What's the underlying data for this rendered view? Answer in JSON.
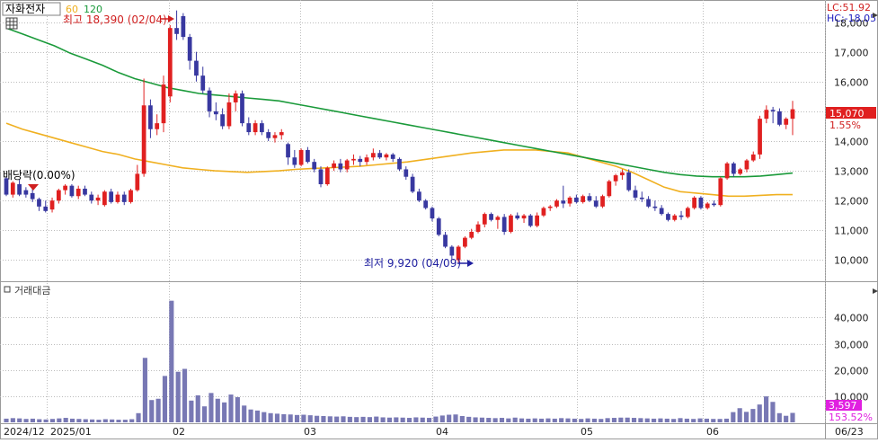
{
  "legend": {
    "symbol": "자화전자",
    "ma60_label": "60",
    "ma120_label": "120"
  },
  "colors": {
    "up": "#e02020",
    "down": "#3838a0",
    "ma60": "#f0b020",
    "ma120": "#1a9a3a",
    "volume": "#7878b4",
    "grid": "#bcbcbc",
    "annotation": "#d02020",
    "annotation_low": "#2020a0",
    "price_tag_bg": "#e02020",
    "volume_tag_bg": "#e020e0"
  },
  "info": {
    "lc": "LC:51.92",
    "hc": "HC:-18.05"
  },
  "annotations": {
    "high": "최고 18,390 (02/04)",
    "low": "최저 9,920 (04/09)",
    "dividend": "배당락(0.00%)"
  },
  "tags": {
    "price": "15,070",
    "price_pct": "1.55%",
    "volume": "3,597",
    "volume_pct": "153.52%"
  },
  "volume_title": "거래대금",
  "chart_data": [
    {
      "type": "candlestick",
      "title": "자화전자",
      "y_ticks": [
        10000,
        11000,
        12000,
        13000,
        14000,
        15000,
        16000,
        17000,
        18000
      ],
      "y_tick_labels": [
        "10,000",
        "11,000",
        "12,000",
        "13,000",
        "14,000",
        "15,000",
        "16,000",
        "17,000",
        "18,000"
      ],
      "ylim": [
        9500,
        18500
      ],
      "x_labels": [
        "2024/12",
        "2025/01",
        "02",
        "03",
        "04",
        "05",
        "06",
        "06/23"
      ],
      "candles": [
        [
          12750,
          12800,
          12150,
          12200
        ],
        [
          12200,
          12650,
          12100,
          12600
        ],
        [
          12550,
          12700,
          12150,
          12200
        ],
        [
          12350,
          12450,
          12100,
          12200
        ],
        [
          12250,
          12400,
          11950,
          12050
        ],
        [
          12050,
          12100,
          11650,
          11800
        ],
        [
          11800,
          12000,
          11600,
          11650
        ],
        [
          11700,
          12100,
          11600,
          12000
        ],
        [
          12000,
          12400,
          11900,
          12350
        ],
        [
          12350,
          12550,
          12200,
          12500
        ],
        [
          12500,
          12550,
          12100,
          12150
        ],
        [
          12150,
          12500,
          12050,
          12400
        ],
        [
          12400,
          12500,
          12150,
          12200
        ],
        [
          12200,
          12300,
          11900,
          12000
        ],
        [
          12000,
          12200,
          11850,
          12100
        ],
        [
          11850,
          12350,
          11800,
          12300
        ],
        [
          12300,
          12400,
          11900,
          11950
        ],
        [
          11950,
          12300,
          11900,
          12200
        ],
        [
          12200,
          12300,
          11850,
          11950
        ],
        [
          11950,
          12400,
          11900,
          12350
        ],
        [
          12350,
          13200,
          12300,
          12900
        ],
        [
          12900,
          16100,
          12800,
          15200
        ],
        [
          15200,
          15400,
          14100,
          14400
        ],
        [
          14400,
          14900,
          14200,
          14600
        ],
        [
          14600,
          16200,
          14300,
          15900
        ],
        [
          15500,
          17900,
          15300,
          17800
        ],
        [
          17800,
          18390,
          17400,
          17600
        ],
        [
          18200,
          18300,
          17400,
          17500
        ],
        [
          17500,
          17600,
          16400,
          16700
        ],
        [
          16700,
          17000,
          16000,
          16200
        ],
        [
          16200,
          16500,
          15600,
          15700
        ],
        [
          15700,
          15800,
          14800,
          15000
        ],
        [
          15000,
          15300,
          14700,
          14900
        ],
        [
          14900,
          15100,
          14400,
          14500
        ],
        [
          14500,
          15600,
          14400,
          15300
        ],
        [
          15300,
          15700,
          15000,
          15600
        ],
        [
          15600,
          15700,
          14500,
          14600
        ],
        [
          14600,
          14800,
          14200,
          14300
        ],
        [
          14300,
          14700,
          14200,
          14600
        ],
        [
          14600,
          14700,
          14200,
          14300
        ],
        [
          14300,
          14400,
          14000,
          14100
        ],
        [
          14100,
          14300,
          13950,
          14200
        ],
        [
          14200,
          14400,
          14050,
          14300
        ],
        [
          13900,
          13950,
          13200,
          13450
        ],
        [
          13450,
          13700,
          13100,
          13200
        ],
        [
          13200,
          13750,
          13150,
          13700
        ],
        [
          13700,
          13800,
          13250,
          13300
        ],
        [
          13300,
          13400,
          12950,
          13050
        ],
        [
          13050,
          13150,
          12450,
          12550
        ],
        [
          12550,
          13150,
          12500,
          13100
        ],
        [
          13100,
          13350,
          13000,
          13250
        ],
        [
          13250,
          13400,
          12950,
          13050
        ],
        [
          13050,
          13400,
          12950,
          13350
        ],
        [
          13350,
          13550,
          13200,
          13400
        ],
        [
          13400,
          13500,
          13150,
          13300
        ],
        [
          13300,
          13550,
          13200,
          13450
        ],
        [
          13450,
          13750,
          13350,
          13600
        ],
        [
          13600,
          13700,
          13400,
          13450
        ],
        [
          13450,
          13600,
          13350,
          13550
        ],
        [
          13550,
          13600,
          13300,
          13400
        ],
        [
          13400,
          13450,
          13000,
          13050
        ],
        [
          13050,
          13150,
          12700,
          12800
        ],
        [
          12800,
          12900,
          12250,
          12300
        ],
        [
          12300,
          12400,
          11950,
          12000
        ],
        [
          12000,
          12050,
          11700,
          11750
        ],
        [
          11750,
          11800,
          11300,
          11400
        ],
        [
          11400,
          11450,
          10800,
          10850
        ],
        [
          10850,
          10950,
          10400,
          10450
        ],
        [
          10450,
          10500,
          10000,
          10150
        ],
        [
          10000,
          10500,
          9920,
          10450
        ],
        [
          10450,
          10800,
          10400,
          10750
        ],
        [
          10750,
          11050,
          10700,
          10950
        ],
        [
          10950,
          11300,
          10900,
          11200
        ],
        [
          11200,
          11600,
          11100,
          11550
        ],
        [
          11550,
          11600,
          11300,
          11350
        ],
        [
          11350,
          11500,
          11050,
          11450
        ],
        [
          11450,
          11550,
          10850,
          10950
        ],
        [
          10950,
          11550,
          10900,
          11500
        ],
        [
          11500,
          11600,
          11350,
          11400
        ],
        [
          11400,
          11550,
          11250,
          11500
        ],
        [
          11500,
          11550,
          11100,
          11150
        ],
        [
          11150,
          11600,
          11100,
          11500
        ],
        [
          11500,
          11800,
          11450,
          11750
        ],
        [
          11750,
          11850,
          11650,
          11800
        ],
        [
          11800,
          12050,
          11750,
          12000
        ],
        [
          12000,
          12500,
          11750,
          11900
        ],
        [
          11900,
          12150,
          11800,
          12100
        ],
        [
          12100,
          12200,
          11900,
          11950
        ],
        [
          11950,
          12200,
          11900,
          12150
        ],
        [
          12150,
          12250,
          11950,
          12000
        ],
        [
          12000,
          12150,
          11750,
          11800
        ],
        [
          11800,
          12200,
          11750,
          12150
        ],
        [
          12150,
          12700,
          12100,
          12650
        ],
        [
          12650,
          12900,
          12500,
          12850
        ],
        [
          12850,
          13050,
          12700,
          12950
        ],
        [
          12950,
          13050,
          12300,
          12350
        ],
        [
          12350,
          12500,
          12000,
          12100
        ],
        [
          12100,
          12300,
          11950,
          12050
        ],
        [
          12050,
          12150,
          11750,
          11800
        ],
        [
          11800,
          12000,
          11650,
          11750
        ],
        [
          11750,
          11850,
          11500,
          11550
        ],
        [
          11550,
          11600,
          11300,
          11350
        ],
        [
          11350,
          11550,
          11300,
          11500
        ],
        [
          11500,
          11650,
          11350,
          11450
        ],
        [
          11450,
          11800,
          11400,
          11750
        ],
        [
          11750,
          12150,
          11700,
          12100
        ],
        [
          12100,
          12150,
          11700,
          11750
        ],
        [
          11750,
          11950,
          11700,
          11900
        ],
        [
          11900,
          12000,
          11800,
          11850
        ],
        [
          11850,
          12800,
          11800,
          12750
        ],
        [
          12750,
          13300,
          12700,
          13250
        ],
        [
          13250,
          13300,
          12800,
          12900
        ],
        [
          12900,
          13100,
          12850,
          13050
        ],
        [
          13050,
          13400,
          12950,
          13350
        ],
        [
          13350,
          13650,
          13300,
          13550
        ],
        [
          13550,
          14850,
          13400,
          14750
        ],
        [
          14750,
          15200,
          14600,
          15050
        ],
        [
          15050,
          15150,
          14600,
          15000
        ],
        [
          15000,
          15100,
          14500,
          14550
        ],
        [
          14550,
          14800,
          14400,
          14750
        ],
        [
          14750,
          15350,
          14200,
          15070
        ]
      ],
      "series": [
        {
          "name": "60",
          "values": [
            14600,
            14400,
            14250,
            14100,
            13950,
            13800,
            13650,
            13550,
            13400,
            13300,
            13200,
            13100,
            13050,
            13000,
            12975,
            12950,
            12975,
            13000,
            13050,
            13075,
            13100,
            13125,
            13150,
            13200,
            13250,
            13300,
            13375,
            13450,
            13525,
            13600,
            13650,
            13700,
            13700,
            13700,
            13650,
            13600,
            13450,
            13300,
            13150,
            12950,
            12700,
            12450,
            12300,
            12250,
            12200,
            12150,
            12150,
            12175,
            12200,
            12200
          ]
        },
        {
          "name": "120",
          "values": [
            17800,
            17600,
            17400,
            17200,
            16950,
            16750,
            16550,
            16300,
            16100,
            15950,
            15800,
            15700,
            15600,
            15550,
            15500,
            15450,
            15400,
            15350,
            15250,
            15150,
            15050,
            14950,
            14850,
            14750,
            14650,
            14550,
            14450,
            14350,
            14250,
            14150,
            14050,
            13950,
            13850,
            13750,
            13650,
            13550,
            13450,
            13350,
            13250,
            13150,
            13050,
            12950,
            12875,
            12825,
            12800,
            12800,
            12800,
            12825,
            12875,
            12925
          ]
        }
      ]
    },
    {
      "type": "bar",
      "title": "거래대금",
      "y_ticks": [
        10000,
        20000,
        30000,
        40000
      ],
      "y_tick_labels": [
        "10,000",
        "20,000",
        "30,000",
        "40,000"
      ],
      "ylim": [
        0,
        48000
      ],
      "values": [
        1400,
        1600,
        1500,
        1300,
        1400,
        1200,
        1100,
        1300,
        1500,
        1700,
        1400,
        1300,
        1200,
        1100,
        1000,
        1200,
        1100,
        1000,
        1000,
        1200,
        3500,
        24600,
        8500,
        9000,
        17700,
        46400,
        19300,
        20400,
        8300,
        10300,
        6100,
        11200,
        9000,
        7600,
        10600,
        9600,
        6400,
        4900,
        4500,
        3900,
        3500,
        3300,
        3100,
        3000,
        2800,
        2900,
        2700,
        2500,
        2400,
        2300,
        2200,
        2300,
        2100,
        2000,
        2100,
        2000,
        2200,
        1900,
        1800,
        1900,
        1800,
        1700,
        1900,
        1800,
        1700,
        2200,
        2600,
        2900,
        3000,
        2400,
        2100,
        1900,
        1800,
        1700,
        1600,
        1700,
        1500,
        1800,
        1500,
        1400,
        1500,
        1400,
        1500,
        1400,
        1600,
        1500,
        1400,
        1300,
        1500,
        1400,
        1300,
        1600,
        1700,
        1800,
        1800,
        1700,
        1600,
        1500,
        1400,
        1500,
        1400,
        1300,
        1600,
        1400,
        1300,
        1500,
        1400,
        1300,
        1300,
        1400,
        3900,
        5400,
        4000,
        5100,
        6800,
        9900,
        7800,
        3500,
        2500,
        3597
      ]
    }
  ]
}
